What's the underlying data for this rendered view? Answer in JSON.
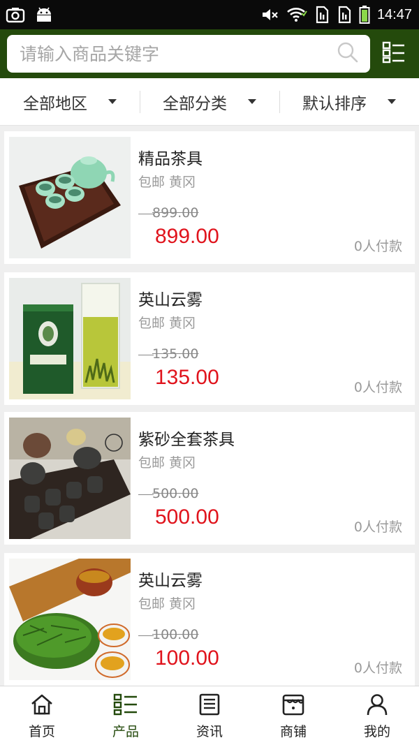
{
  "status_bar": {
    "time": "14:47",
    "icons": [
      "screenshot-icon",
      "android-icon",
      "mute-icon",
      "wifi-icon",
      "sim1-icon",
      "sim2-icon",
      "battery-icon"
    ]
  },
  "search": {
    "placeholder": "请输入商品关键字",
    "value": ""
  },
  "filters": [
    {
      "label": "全部地区"
    },
    {
      "label": "全部分类"
    },
    {
      "label": "默认排序"
    }
  ],
  "products": [
    {
      "title": "精品茶具",
      "meta": "包邮 黄冈",
      "old_price": "899.00",
      "price": "899.00",
      "paid": "0人付款"
    },
    {
      "title": "英山云雾",
      "meta": "包邮 黄冈",
      "old_price": "135.00",
      "price": "135.00",
      "paid": "0人付款"
    },
    {
      "title": "紫砂全套茶具",
      "meta": "包邮 黄冈",
      "old_price": "500.00",
      "price": "500.00",
      "paid": "0人付款"
    },
    {
      "title": "英山云雾",
      "meta": "包邮 黄冈",
      "old_price": "100.00",
      "price": "100.00",
      "paid": "0人付款"
    }
  ],
  "nav": [
    {
      "label": "首页",
      "icon": "home-icon"
    },
    {
      "label": "产品",
      "icon": "product-grid-icon",
      "active": true
    },
    {
      "label": "资讯",
      "icon": "news-icon"
    },
    {
      "label": "商铺",
      "icon": "shop-icon"
    },
    {
      "label": "我的",
      "icon": "user-icon"
    }
  ],
  "colors": {
    "header": "#244a0c",
    "price": "#e0131c",
    "active_nav": "#244a0c"
  }
}
